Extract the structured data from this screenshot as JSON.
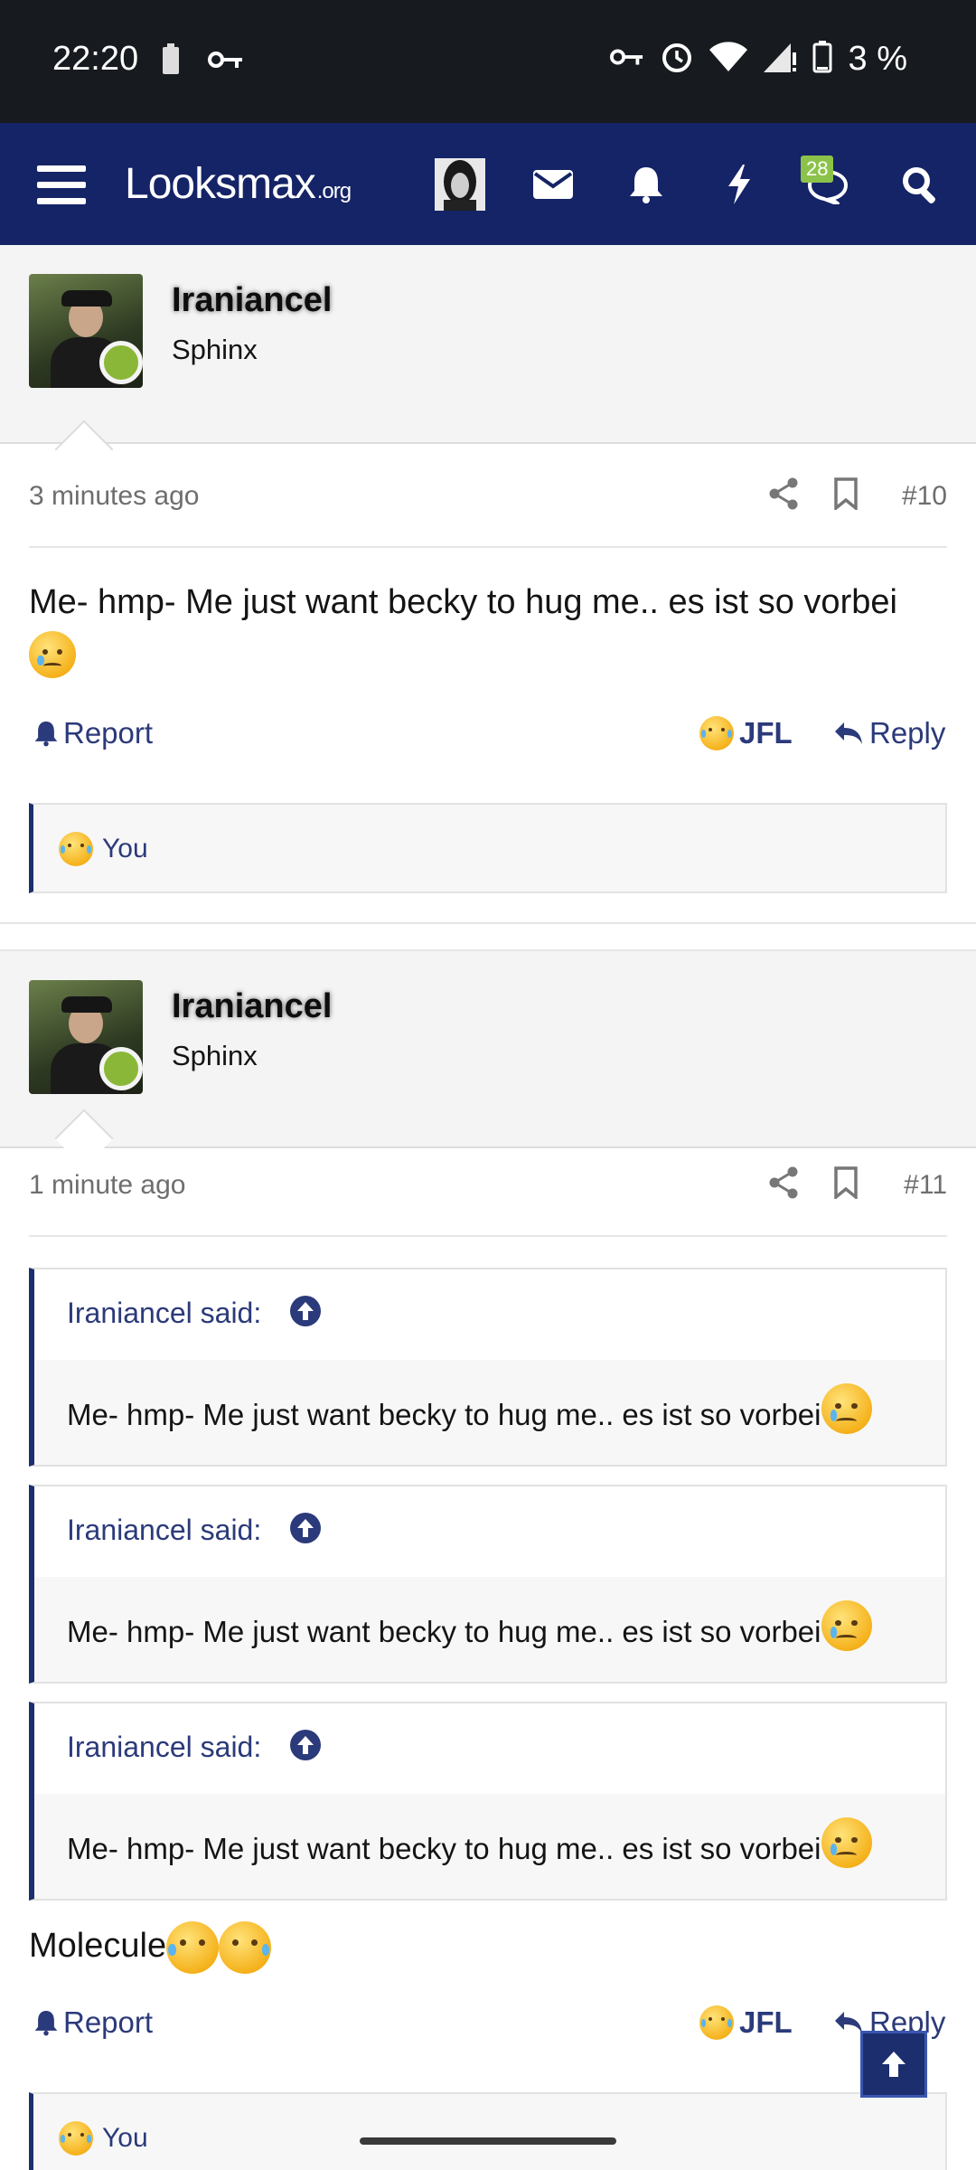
{
  "status_bar": {
    "time": "22:20",
    "battery_percent": "3 %"
  },
  "nav": {
    "logo_main": "Looksmax",
    "logo_suffix": ".org",
    "conversations_badge": "28",
    "accent": "#152367"
  },
  "posts": [
    {
      "username": "Iraniancel",
      "user_title": "Sphinx",
      "time_ago": "3 minutes ago",
      "post_number": "#10",
      "message": "Me- hmp- Me just want becky to hug me.. es ist so vorbei",
      "message_emoji": "crying-face",
      "report_label": "Report",
      "jfl_label": "JFL",
      "reply_label": "Reply",
      "reactions_label": "You"
    },
    {
      "username": "Iraniancel",
      "user_title": "Sphinx",
      "time_ago": "1 minute ago",
      "post_number": "#11",
      "quotes": [
        {
          "author_label": "Iraniancel said:",
          "text": "Me- hmp- Me just want becky to hug me.. es ist so vorbei"
        },
        {
          "author_label": "Iraniancel said:",
          "text": "Me- hmp- Me just want becky to hug me.. es ist so vorbei"
        },
        {
          "author_label": "Iraniancel said:",
          "text": "Me- hmp- Me just want becky to hug me.. es ist so vorbei"
        }
      ],
      "message": "Molecule",
      "message_emoji": "grinning-cat-with-tears",
      "report_label": "Report",
      "jfl_label": "JFL",
      "reply_label": "Reply",
      "reactions_label": "You"
    }
  ]
}
